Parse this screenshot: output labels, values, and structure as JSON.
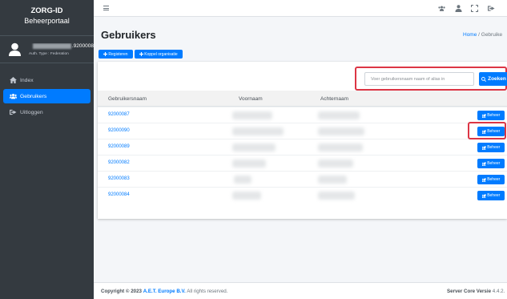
{
  "sidebar": {
    "brand_title": "ZORG-ID",
    "brand_subtitle": "Beheerportaal",
    "user_name_suffix": ".9200008",
    "user_auth": "Auth. Type : Federation",
    "nav": [
      {
        "label": "Index",
        "icon": "home-icon"
      },
      {
        "label": "Gebruikers",
        "icon": "users-icon",
        "active": true
      },
      {
        "label": "Uitloggen",
        "icon": "sign-out-icon"
      }
    ]
  },
  "header": {
    "title": "Gebruikers",
    "breadcrumb_home": "Home",
    "breadcrumb_sep": " / ",
    "breadcrumb_current": "Gebruike"
  },
  "actions": {
    "register_label": "Registeren",
    "link_org_label": "Koppel organisatie"
  },
  "search": {
    "placeholder": "Voer gebruikersnaam naam of alias in",
    "button_label": "Zoeken"
  },
  "table": {
    "columns": [
      "Gebruikersnaam",
      "Voornaam",
      "Achternaam"
    ],
    "rows": [
      {
        "username": "92000087"
      },
      {
        "username": "92000090"
      },
      {
        "username": "92000089"
      },
      {
        "username": "92000082"
      },
      {
        "username": "92000083"
      },
      {
        "username": "92000084"
      }
    ],
    "action_label": "Beheer"
  },
  "footer": {
    "copyright_prefix": "Copyright © 2023",
    "company": "A.E.T. Europe B.V.",
    "rights": "All rights reserved.",
    "version_label": "Server Core Versie",
    "version": "4.4.2."
  },
  "colors": {
    "sidebar_bg": "#343a40",
    "accent": "#007bff",
    "highlight": "#dc3545"
  }
}
